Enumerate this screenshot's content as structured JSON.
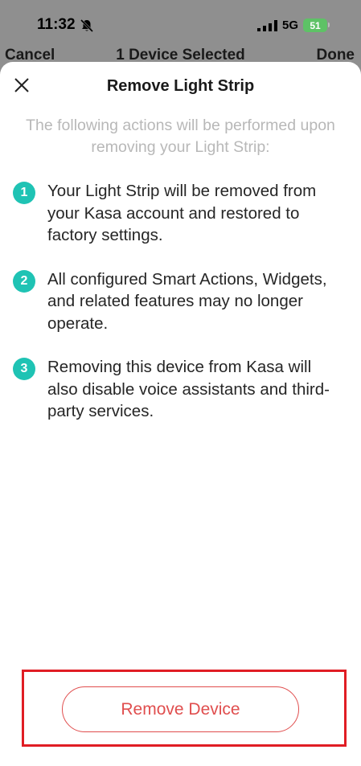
{
  "status_bar": {
    "time": "11:32",
    "network": "5G",
    "battery": "51"
  },
  "nav": {
    "cancel_label": "Cancel",
    "title": "1 Device Selected",
    "done_label": "Done"
  },
  "sheet": {
    "title": "Remove Light Strip",
    "intro": "The following actions will be performed upon removing your Light Strip:",
    "steps": [
      {
        "number": "1",
        "text": "Your Light Strip will be removed from your Kasa account and restored to factory settings."
      },
      {
        "number": "2",
        "text": "All configured Smart Actions, Widgets, and related features may no longer operate."
      },
      {
        "number": "3",
        "text": "Removing this device from Kasa will also disable voice assistants and third-party services."
      }
    ],
    "remove_button_label": "Remove Device"
  },
  "colors": {
    "accent": "#1fc3b4",
    "danger": "#e04e4e",
    "highlight": "#e01d24"
  }
}
